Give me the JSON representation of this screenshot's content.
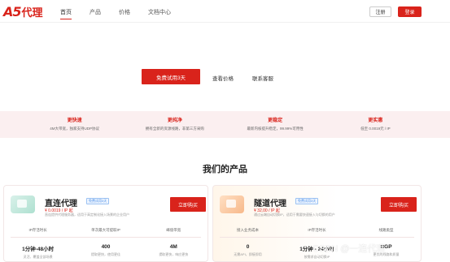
{
  "header": {
    "logo_text": "A5",
    "logo_cn": "代理",
    "nav": [
      "首页",
      "产品",
      "价格",
      "文档中心"
    ],
    "register_label": "注册",
    "login_label": "登录"
  },
  "hero": {
    "trial_label": "免费试用3天",
    "price_link": "查看价格",
    "service_link": "联系客服"
  },
  "features": [
    {
      "title": "更快速",
      "desc": "4M大带宽，独家支持UDP协议"
    },
    {
      "title": "更纯净",
      "desc": "拥有全新的资源线路，非第三方采购"
    },
    {
      "title": "更稳定",
      "desc": "最新内核提升稳定，99.99%可用性"
    },
    {
      "title": "更实惠",
      "desc": "低至 0.0019元 / IP"
    }
  ],
  "section_title": "我们的产品",
  "products": [
    {
      "name": "直连代理",
      "tag": "免费试用3天",
      "price": "¥ 0.0019 / IP 起",
      "note": "直连提供代理服务器，适用于高定制化接入场景的企业用户",
      "buy_label": "立即购买",
      "stats": [
        {
          "label": "IP存活时长",
          "value": "1分钟-48小时",
          "desc": "灵活、覆盖全部场景"
        },
        {
          "label": "单次最大可提取IP",
          "value": "400",
          "desc": "提取更快，使用更佳"
        },
        {
          "label": "峰值带宽",
          "value": "4M",
          "desc": "提取更快，响应更快"
        }
      ]
    },
    {
      "name": "隧道代理",
      "tag": "免费试用3天",
      "price": "¥ 32.00 / IP 起",
      "note": "通过云端自动切换IP，适用于需要快速接入与切换的用户",
      "buy_label": "立即购买",
      "stats": [
        {
          "label": "接入业务成本",
          "value": "0",
          "desc": "无需API，即接即用"
        },
        {
          "label": "IP存活时长",
          "value": "1分钟 - 24小时",
          "desc": "按需求自动切换IP"
        },
        {
          "label": "线路类型",
          "value": "BGP",
          "desc": "更优的线路和质量"
        }
      ]
    }
  ],
  "watermark": "CSDN @一连代理"
}
